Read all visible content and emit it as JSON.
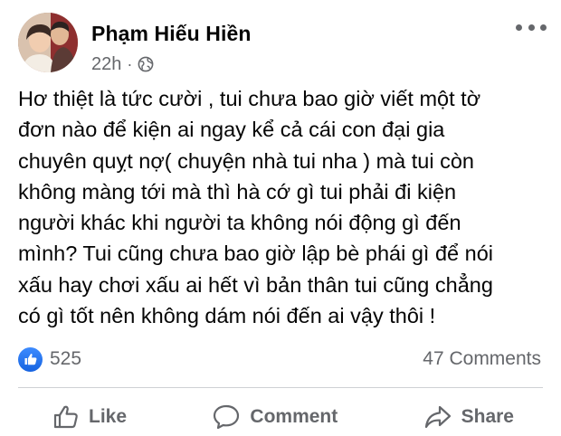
{
  "post": {
    "author": "Phạm Hiếu Hiền",
    "time": "22h",
    "separator": "·",
    "privacy_icon": "globe-icon",
    "more_icon": "more-dots-icon",
    "text": "Hơ thiệt là tức cười , tui chưa bao giờ viết một tờ\nđơn nào để kiện ai ngay kể cả cái con đại gia\nchuyên quỵt nợ( chuyện nhà tui nha ) mà tui còn\nkhông màng tới mà thì hà cớ gì tui phải đi kiện\nngười khác khi người ta không nói động gì đến\nmình? Tui cũng chưa bao giờ lập bè phái gì để nói\nxấu hay chơi xấu ai hết vì bản thân tui cũng chẳng\ncó gì tốt nên không dám nói đến ai vậy thôi !"
  },
  "stats": {
    "reaction_icon": "like-reaction-icon",
    "reaction_count": "525",
    "comments": "47 Comments"
  },
  "actions": {
    "like": "Like",
    "comment": "Comment",
    "share": "Share"
  },
  "colors": {
    "text": "#050505",
    "secondary": "#65676b",
    "like_blue": "#1877f2",
    "divider": "#ced0d4"
  }
}
